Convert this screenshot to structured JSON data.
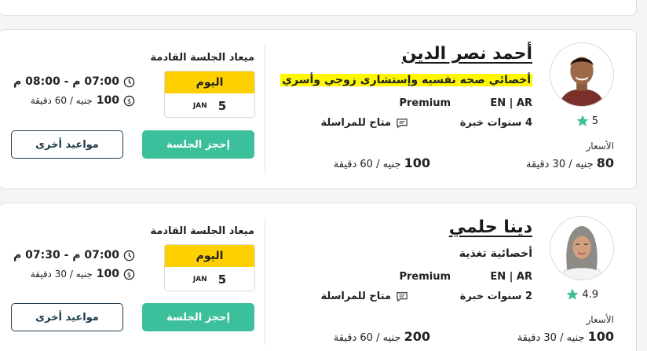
{
  "doctors": [
    {
      "name": "أحمد نصر الدين",
      "specialty": "أخصائي صحه نفسيه وإستشارى زوجي وأسري",
      "specialty_highlighted": true,
      "rating": "5",
      "languages": "EN | AR",
      "tier": "Premium",
      "experience": "4 سنوات خبرة",
      "messaging": "متاح للمراسلة",
      "prices_label": "الأسعار",
      "price_1_amount": "80",
      "price_1_rest": "جنيه / 30 دقيقة",
      "price_2_amount": "100",
      "price_2_rest": "جنيه / 60 دقيقة",
      "next_session_label": "ميعاد الجلسة القادمة",
      "date_today": "اليوم",
      "date_month": "JAN",
      "date_day": "5",
      "time_text": "07:00 م - 08:00 م",
      "fee_amount": "100",
      "fee_rest": "جنيه / 60 دقيقة",
      "book_button": "إحجز الجلسة",
      "other_button": "مواعيد أخرى"
    },
    {
      "name": "دينا حلمي",
      "specialty": "أخصائية تغذية",
      "specialty_highlighted": false,
      "rating": "4.9",
      "languages": "EN | AR",
      "tier": "Premium",
      "experience": "2 سنوات خبرة",
      "messaging": "متاح للمراسلة",
      "prices_label": "الأسعار",
      "price_1_amount": "100",
      "price_1_rest": "جنيه / 30 دقيقة",
      "price_2_amount": "200",
      "price_2_rest": "جنيه / 60 دقيقة",
      "next_session_label": "ميعاد الجلسة القادمة",
      "date_today": "اليوم",
      "date_month": "JAN",
      "date_day": "5",
      "time_text": "07:00 م - 07:30 م",
      "fee_amount": "100",
      "fee_rest": "جنيه / 30 دقيقة",
      "book_button": "إحجز الجلسة",
      "other_button": "مواعيد أخرى"
    }
  ],
  "colors": {
    "accent_green": "#3cbf9b",
    "date_yellow": "#ffd000",
    "highlight": "#fff700",
    "star": "#3cbf9b"
  },
  "icons": [
    "star-icon",
    "chat-icon",
    "clock-icon",
    "currency-icon"
  ]
}
